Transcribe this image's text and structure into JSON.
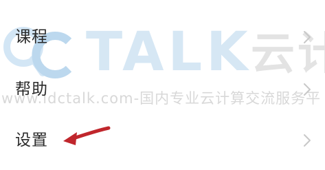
{
  "menu": {
    "items": [
      {
        "label": "课程"
      },
      {
        "label": "帮助"
      },
      {
        "label": "设置"
      }
    ]
  },
  "watermark": {
    "brand": "TALK",
    "brand_cn": "云计",
    "url_text": "www.idctalk.com-国内专业云计算交流服务平"
  },
  "colors": {
    "label": "#2a2a2a",
    "chevron": "#c8c8c8",
    "arrow": "#c0262c",
    "watermark_blue": "#cfe3f3",
    "watermark_gray": "#dddddd"
  }
}
